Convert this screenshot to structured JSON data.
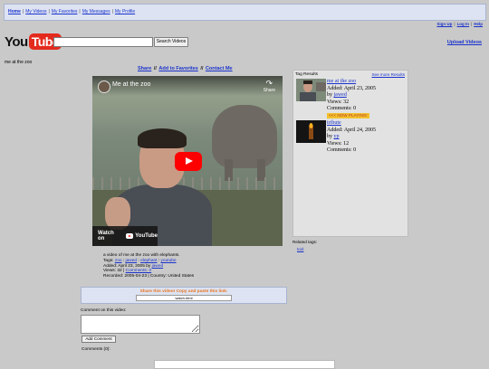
{
  "nav": {
    "items": [
      {
        "label": "Home"
      },
      {
        "label": "My Videos"
      },
      {
        "label": "My Favorites"
      },
      {
        "label": "My Messages"
      },
      {
        "label": "My Profile"
      }
    ]
  },
  "userlinks": {
    "signup": "Sign Up",
    "login": "Log In",
    "help": "Help"
  },
  "logo": {
    "you": "You",
    "tube": "Tube"
  },
  "search": {
    "value": "",
    "button": "Search Videos"
  },
  "upload": "Upload Videos",
  "video": {
    "page_title": "me at the zoo",
    "player_title": "Me at the zoo",
    "share_overlay": "Share",
    "watch_on": "Watch on",
    "watch_on_brand": "YouTube"
  },
  "sharebar": {
    "share": "Share",
    "favorites": "Add to Favorites",
    "contact": "Contact Me"
  },
  "meta": {
    "description": "a video of me at the zoo with elephants.",
    "tags_label": "Tags:",
    "tags": [
      "zoo",
      "jawed",
      "elephant",
      "youtube"
    ],
    "added": "Added: April 23, 2005 by",
    "added_user": "jawed",
    "views": "Views: 32 |",
    "comments_link": "Comments: 0",
    "recorded": "Recorded: 2005-04-23 | Country: United States"
  },
  "embed": {
    "label": "Share this video! Copy and paste this link:",
    "code": "watch.html"
  },
  "comment": {
    "label": "Comment on this video:",
    "button": "Add Comment",
    "count": "Comments (0):"
  },
  "tagpanel": {
    "header": "Tag Results",
    "more": "See more Results",
    "results": [
      {
        "title": "me at the zoo",
        "added": "Added: April 23, 2005",
        "by": "by",
        "user": "jawed",
        "views": "Views: 32",
        "comments": "Comments: 0",
        "now_playing": "<<< NOW PLAYING!"
      },
      {
        "title": "tribute",
        "added": "Added: April 24, 2005",
        "by": "by",
        "user": "yp",
        "views": "Views: 12",
        "comments": "Comments: 0"
      }
    ]
  },
  "related": {
    "label": "Related tags:",
    "tags": [
      "tool"
    ]
  },
  "colors": {
    "background": "#c9c9c9",
    "link": "#1a33cc",
    "nav_bg": "#dde3f2",
    "logo_red": "#e42a1d",
    "now_playing": "#f2c22b"
  }
}
